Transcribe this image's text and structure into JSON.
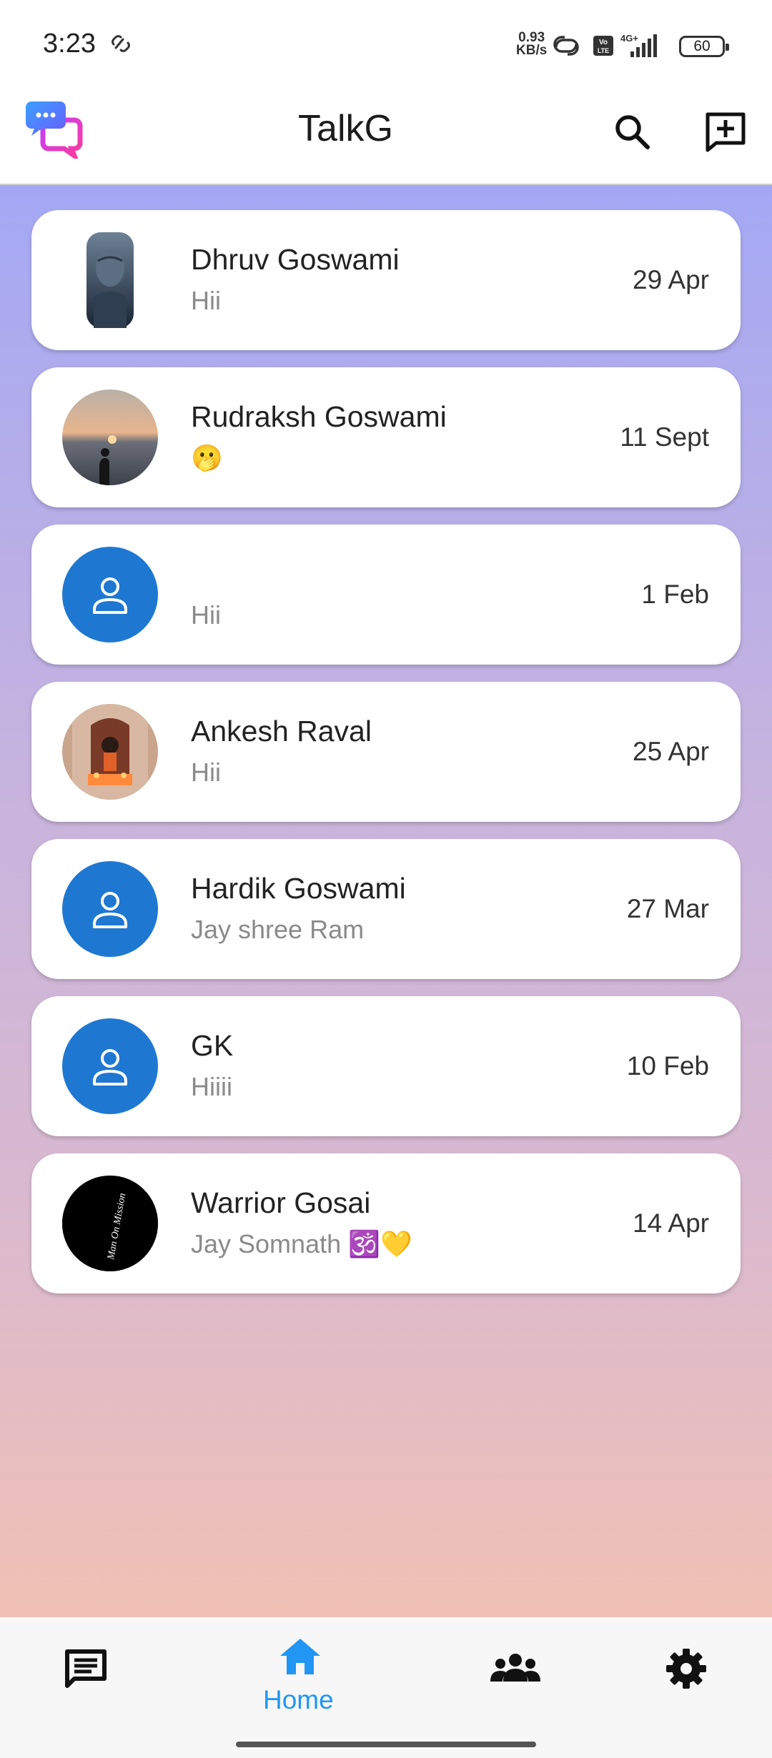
{
  "status_bar": {
    "time": "3:23",
    "net_speed_top": "0.93",
    "net_speed_bottom": "KB/s",
    "network": "4G+",
    "volte": "Vo LTE",
    "battery": "60"
  },
  "app_bar": {
    "title": "TalkG",
    "icons": [
      "app-logo",
      "search-icon",
      "add-chat-icon"
    ]
  },
  "chats": [
    {
      "name": "Dhruv Goswami",
      "message": "Hii",
      "date": "29 Apr",
      "avatar": "photo-shiva"
    },
    {
      "name": "Rudraksh Goswami",
      "message": "🫢",
      "date": "11 Sept",
      "avatar": "photo-sunset"
    },
    {
      "name": "",
      "message": "Hii",
      "date": "1 Feb",
      "avatar": "default-person"
    },
    {
      "name": "Ankesh Raval",
      "message": "Hii",
      "date": "25 Apr",
      "avatar": "photo-temple"
    },
    {
      "name": "Hardik Goswami",
      "message": "Jay shree Ram",
      "date": "27 Mar",
      "avatar": "default-person"
    },
    {
      "name": "GK",
      "message": "Hiiii",
      "date": "10 Feb",
      "avatar": "default-person"
    },
    {
      "name": "Warrior Gosai",
      "message": "Jay Somnath 🕉️💛",
      "date": "14 Apr",
      "avatar": "photo-man-on-mission",
      "avatar_text": "Man On Mission"
    }
  ],
  "bottom_nav": {
    "items": [
      {
        "icon": "chat-icon",
        "label": ""
      },
      {
        "icon": "home-icon",
        "label": "Home",
        "active": true
      },
      {
        "icon": "groups-icon",
        "label": ""
      },
      {
        "icon": "settings-icon",
        "label": ""
      }
    ]
  },
  "colors": {
    "accent": "#2196f3",
    "avatar_default": "#1e78d2",
    "gradient_top": "#a4a8f4",
    "gradient_bottom": "#f0c0b4"
  }
}
